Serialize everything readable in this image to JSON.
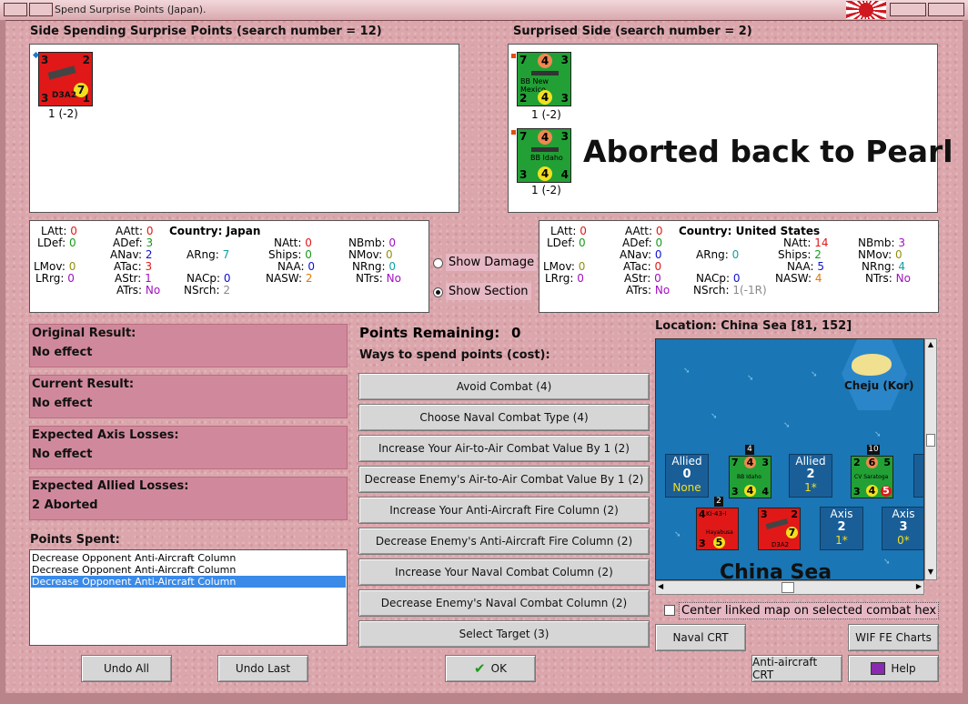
{
  "window": {
    "title": "Spend Surprise Points (Japan)."
  },
  "left_panel": {
    "heading": "Side Spending Surprise Points (search number = 12)",
    "units": [
      {
        "name": "D3A2",
        "top_left": "3",
        "top_right": "2",
        "bottom_left": "3",
        "bottom_right": "1",
        "center": "7",
        "caption": "1 (-2)"
      }
    ]
  },
  "right_panel": {
    "heading": "Surprised Side (search number = 2)",
    "units": [
      {
        "name": "BB New Mexico",
        "top_left": "7",
        "top_mid": "4",
        "top_right": "3",
        "bottom_left": "2",
        "bottom_mid": "4",
        "bottom_right": "3",
        "caption": "1 (-2)"
      },
      {
        "name": "BB Idaho",
        "top_left": "7",
        "top_mid": "4",
        "top_right": "3",
        "bottom_left": "3",
        "bottom_mid": "4",
        "bottom_right": "4",
        "caption": "1 (-2)"
      }
    ],
    "annotation": "Aborted back to Pearl"
  },
  "stats_japan": {
    "country_label": "Country:",
    "country": "Japan",
    "latt": [
      "LAtt:",
      "0"
    ],
    "ldef": [
      "LDef:",
      "0"
    ],
    "lmov": [
      "LMov:",
      "0"
    ],
    "lrrg": [
      "LRrg:",
      "0"
    ],
    "aatt": [
      "AAtt:",
      "0"
    ],
    "adef": [
      "ADef:",
      "3"
    ],
    "anav": [
      "ANav:",
      "2"
    ],
    "atac": [
      "ATac:",
      "3"
    ],
    "astr": [
      "AStr:",
      "1"
    ],
    "atrs": [
      "ATrs:",
      "No"
    ],
    "arng": [
      "ARng:",
      "7"
    ],
    "nacp": [
      "NACp:",
      "0"
    ],
    "nsrch": [
      "NSrch:",
      "2"
    ],
    "natt": [
      "NAtt:",
      "0"
    ],
    "ships": [
      "Ships:",
      "0"
    ],
    "naa": [
      "NAA:",
      "0"
    ],
    "nasw": [
      "NASW:",
      "2"
    ],
    "nbmb": [
      "NBmb:",
      "0"
    ],
    "nmov": [
      "NMov:",
      "0"
    ],
    "nrng": [
      "NRng:",
      "0"
    ],
    "ntrs": [
      "NTrs:",
      "No"
    ]
  },
  "stats_us": {
    "country_label": "Country:",
    "country": "United States",
    "latt": [
      "LAtt:",
      "0"
    ],
    "ldef": [
      "LDef:",
      "0"
    ],
    "lmov": [
      "LMov:",
      "0"
    ],
    "lrrg": [
      "LRrg:",
      "0"
    ],
    "aatt": [
      "AAtt:",
      "0"
    ],
    "adef": [
      "ADef:",
      "0"
    ],
    "anav": [
      "ANav:",
      "0"
    ],
    "atac": [
      "ATac:",
      "0"
    ],
    "astr": [
      "AStr:",
      "0"
    ],
    "atrs": [
      "ATrs:",
      "No"
    ],
    "arng": [
      "ARng:",
      "0"
    ],
    "nacp": [
      "NACp:",
      "0"
    ],
    "nsrch": [
      "NSrch:",
      "1(-1R)"
    ],
    "natt": [
      "NAtt:",
      "14"
    ],
    "ships": [
      "Ships:",
      "2"
    ],
    "naa": [
      "NAA:",
      "5"
    ],
    "nasw": [
      "NASW:",
      "4"
    ],
    "nbmb": [
      "NBmb:",
      "3"
    ],
    "nmov": [
      "NMov:",
      "0"
    ],
    "nrng": [
      "NRng:",
      "4"
    ],
    "ntrs": [
      "NTrs:",
      "No"
    ]
  },
  "options": {
    "show_damage": "Show Damage",
    "show_section": "Show Section"
  },
  "results": [
    {
      "label": "Original Result:",
      "value": "No effect"
    },
    {
      "label": "Current Result:",
      "value": "No effect"
    },
    {
      "label": "Expected Axis Losses:",
      "value": "No effect"
    },
    {
      "label": "Expected Allied Losses:",
      "value": "2 Aborted"
    }
  ],
  "points_spent": {
    "label": "Points Spent:",
    "items": [
      "Decrease Opponent Anti-Aircraft Column",
      "Decrease Opponent Anti-Aircraft Column",
      "Decrease Opponent Anti-Aircraft Column"
    ]
  },
  "points": {
    "remaining_label": "Points Remaining:",
    "remaining": "0",
    "ways_label": "Ways to spend points (cost):"
  },
  "spend_buttons": [
    "Avoid Combat (4)",
    "Choose Naval Combat Type (4)",
    "Increase Your Air-to-Air Combat Value By 1 (2)",
    "Decrease Enemy's Air-to-Air Combat Value By 1 (2)",
    "Increase Your Anti-Aircraft Fire Column (2)",
    "Decrease Enemy's Anti-Aircraft Fire Column (2)",
    "Increase Your Naval Combat Column (2)",
    "Decrease Enemy's Naval Combat Column (2)",
    "Select Target (3)"
  ],
  "location": {
    "label": "Location: China Sea [81, 152]"
  },
  "map": {
    "sea_label": "China Sea",
    "island": "Cheju (Kor)",
    "allied1": {
      "side": "Allied",
      "count": "0",
      "note": "None"
    },
    "allied2": {
      "side": "Allied",
      "count": "2",
      "note": "1*"
    },
    "axis1": {
      "side": "Axis",
      "count": "2",
      "note": "1*"
    },
    "axis2": {
      "side": "Axis",
      "count": "3",
      "note": "0*"
    },
    "stack1": "4",
    "stack2": "10",
    "stack3": "2",
    "unit_idaho": {
      "name": "BB Idaho",
      "a": "7",
      "b": "4",
      "c": "3",
      "d": "3",
      "e": "4",
      "f": "4"
    },
    "unit_saratoga": {
      "name": "CV Saratoga",
      "a": "2",
      "b": "6",
      "c": "5",
      "d": "3",
      "e": "4",
      "f": "5"
    },
    "unit_ki43": {
      "name": "Ki-43-I",
      "sub": "Hayabusa",
      "a": "4",
      "b": "3",
      "c": "5"
    },
    "unit_d3a2": {
      "name": "D3A2",
      "a": "3",
      "b": "2",
      "c": "7"
    }
  },
  "center_map_label": "Center linked map on selected combat hex",
  "buttons": {
    "undo_all": "Undo All",
    "undo_last": "Undo Last",
    "ok": "OK",
    "naval_crt": "Naval CRT",
    "wif_fe_charts": "WIF FE Charts",
    "aa_crt": "Anti-aircraft CRT",
    "help": "Help"
  },
  "colors": {
    "japan_unit": "#e01818",
    "us_unit": "#22a035",
    "panel_pink": "#d0899c",
    "map_sea": "#1a76b4"
  }
}
